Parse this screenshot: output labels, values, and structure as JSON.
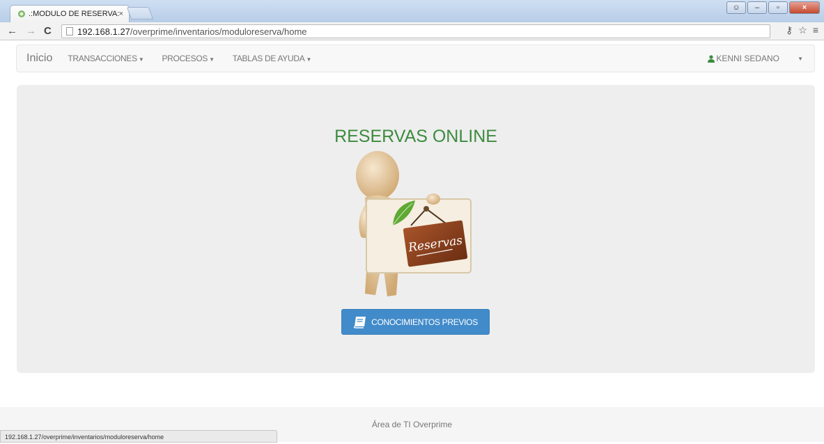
{
  "browser": {
    "tab_title": ".:MODULO DE RESERVA:.",
    "tab_close": "×",
    "url_host": "192.168.1.27",
    "url_path": "/overprime/inventarios/moduloreserva/home",
    "status_url": "192.168.1.27/overprime/inventarios/moduloreserva/home",
    "icons": [
      "back-icon",
      "forward-icon",
      "reload-icon",
      "page-icon",
      "key-icon",
      "star-icon",
      "menu-icon"
    ]
  },
  "navbar": {
    "brand": "Inicio",
    "items": [
      {
        "label": "TRANSACCIONES"
      },
      {
        "label": "PROCESOS"
      },
      {
        "label": "TABLAS DE AYUDA"
      }
    ],
    "user": "KENNI SEDANO"
  },
  "hero": {
    "title": "RESERVAS ONLINE",
    "sign_text": "Reservas",
    "button_label": "CONOCIMIENTOS PREVIOS"
  },
  "footer": {
    "text": "Área de TI Overprime"
  },
  "colors": {
    "title_green": "#3c8b3e",
    "button_blue": "#428bca",
    "jumbotron_bg": "#eeeeee"
  }
}
